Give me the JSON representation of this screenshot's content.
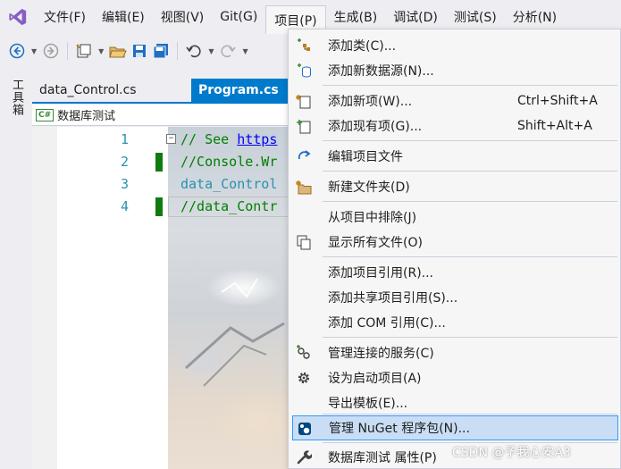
{
  "menubar": {
    "items": [
      "文件(F)",
      "编辑(E)",
      "视图(V)",
      "Git(G)",
      "项目(P)",
      "生成(B)",
      "调试(D)",
      "测试(S)",
      "分析(N)"
    ]
  },
  "toolbox": {
    "label": "工具箱"
  },
  "tabs": [
    {
      "label": "data_Control.cs"
    },
    {
      "label": "Program.cs"
    }
  ],
  "navbar": {
    "badge": "C#",
    "project": "数据库测试"
  },
  "editor": {
    "lines": [
      {
        "num": "1",
        "comment": "// See ",
        "link": "https"
      },
      {
        "num": "2",
        "comment": "//Console.Wr"
      },
      {
        "num": "3",
        "ident": "data_Control"
      },
      {
        "num": "4",
        "comment": "//data_Contr"
      }
    ]
  },
  "project_menu": {
    "items": [
      {
        "label": "添加类(C)...",
        "shortcut": ""
      },
      {
        "label": "添加新数据源(N)...",
        "shortcut": ""
      },
      {
        "label": "添加新项(W)...",
        "shortcut": "Ctrl+Shift+A"
      },
      {
        "label": "添加现有项(G)...",
        "shortcut": "Shift+Alt+A"
      },
      {
        "label": "编辑项目文件",
        "shortcut": ""
      },
      {
        "label": "新建文件夹(D)",
        "shortcut": ""
      },
      {
        "label": "从项目中排除(J)",
        "shortcut": ""
      },
      {
        "label": "显示所有文件(O)",
        "shortcut": ""
      },
      {
        "label": "添加项目引用(R)...",
        "shortcut": ""
      },
      {
        "label": "添加共享项目引用(S)...",
        "shortcut": ""
      },
      {
        "label": "添加 COM 引用(C)...",
        "shortcut": ""
      },
      {
        "label": "管理连接的服务(C)",
        "shortcut": ""
      },
      {
        "label": "设为启动项目(A)",
        "shortcut": ""
      },
      {
        "label": "导出模板(E)...",
        "shortcut": ""
      },
      {
        "label": "管理 NuGet 程序包(N)...",
        "shortcut": ""
      },
      {
        "label": "数据库测试 属性(P)",
        "shortcut": ""
      }
    ]
  },
  "watermark": "CSDN @予我心安A3",
  "colors": {
    "accent": "#007acc",
    "highlight": "#c9def5",
    "highlight_border": "#3399ff",
    "change_marker": "#0f7b0f"
  }
}
